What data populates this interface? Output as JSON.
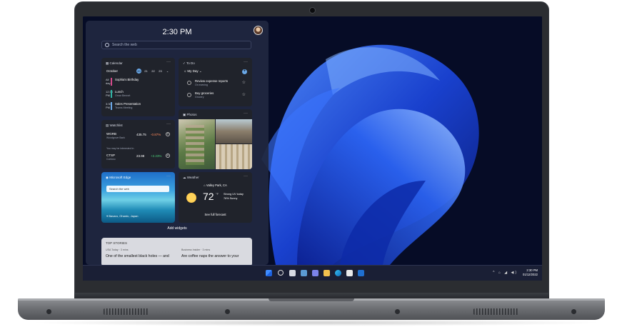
{
  "widgets": {
    "time": "2:30 PM",
    "search_placeholder": "Search the web",
    "add_widgets": "Add widgets"
  },
  "calendar": {
    "title": "Calendar",
    "month": "October",
    "days": [
      "20",
      "21",
      "22",
      "23"
    ],
    "events": [
      {
        "time": "All day",
        "name": "Sophia's Birthday",
        "sub": "",
        "color": "#d44a8a"
      },
      {
        "time": "12:30 PM",
        "name": "Lunch",
        "sub": "Omar Bennet",
        "color": "#2fb3a4"
      },
      {
        "time": "3:30 PM",
        "name": "Sales Presentation",
        "sub": "Teams Meeting",
        "color": "#6aa8e8"
      }
    ]
  },
  "todo": {
    "title": "To Do",
    "list_name": "My Day",
    "tasks": [
      {
        "name": "Review expense reports",
        "sub": "On evening"
      },
      {
        "name": "Buy groceries",
        "sub": "Grocery"
      }
    ]
  },
  "photos": {
    "title": "Photos"
  },
  "watchlist": {
    "title": "Watchlist",
    "hint": "You may be interested in",
    "stocks": [
      {
        "symbol": "WGRB",
        "company": "Woodgrove Bank",
        "price": "435.75",
        "change": "-0.87%",
        "color": "#ff8a5c"
      },
      {
        "symbol": "CTSP",
        "company": "Contoso",
        "price": "23.98",
        "change": "+2.23%",
        "color": "#4cd07a"
      }
    ]
  },
  "edge": {
    "title": "Microsoft Edge",
    "search_placeholder": "Search the web",
    "location": "Bavaro, Ohardc, Japan"
  },
  "weather": {
    "title": "Weather",
    "place": "Valley Park, CA",
    "temp": "72",
    "unit": "°F",
    "condition_1": "Strong UV today",
    "condition_2": "76% Sunny",
    "forecast": "See full forecast"
  },
  "stories": {
    "title": "TOP STORIES",
    "items": [
      {
        "source": "USA Today · 3 mins",
        "headline": "One of the smallest black holes — and"
      },
      {
        "source": "Business Insider · 3 mins",
        "headline": "Are coffee naps the answer to your"
      }
    ]
  },
  "taskbar": {
    "time": "2:30 PM",
    "date": "01/12/2022",
    "tray": "^ ⌂ ◢ ◀)"
  },
  "colors": {
    "accent": "#1f5bd8",
    "taskbar": "#1a1f35",
    "panel": "#21283f"
  }
}
